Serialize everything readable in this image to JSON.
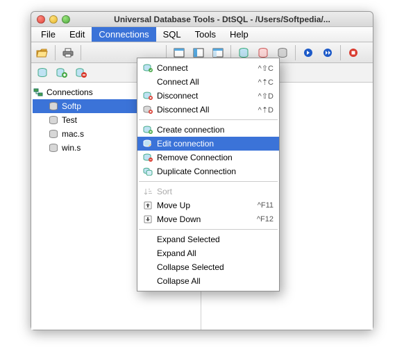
{
  "window": {
    "title": "Universal Database Tools - DtSQL - /Users/Softpedia/..."
  },
  "menubar": {
    "file": "File",
    "edit": "Edit",
    "connections": "Connections",
    "sql": "SQL",
    "tools": "Tools",
    "help": "Help"
  },
  "tree": {
    "root": "Connections",
    "items": [
      "Softp",
      "Test",
      "mac.s",
      "win.s"
    ]
  },
  "dropdown": {
    "connect": "Connect",
    "connect_sc": "^⇧C",
    "connect_all": "Connect All",
    "connect_all_sc": "^⇡C",
    "disconnect": "Disconnect",
    "disconnect_sc": "^⇧D",
    "disconnect_all": "Disconnect All",
    "disconnect_all_sc": "^⇡D",
    "create": "Create connection",
    "edit": "Edit connection",
    "remove": "Remove Connection",
    "duplicate": "Duplicate Connection",
    "sort": "Sort",
    "move_up": "Move Up",
    "move_up_sc": "^F11",
    "move_down": "Move Down",
    "move_down_sc": "^F12",
    "expand_sel": "Expand Selected",
    "expand_all": "Expand All",
    "collapse_sel": "Collapse Selected",
    "collapse_all": "Collapse All"
  }
}
